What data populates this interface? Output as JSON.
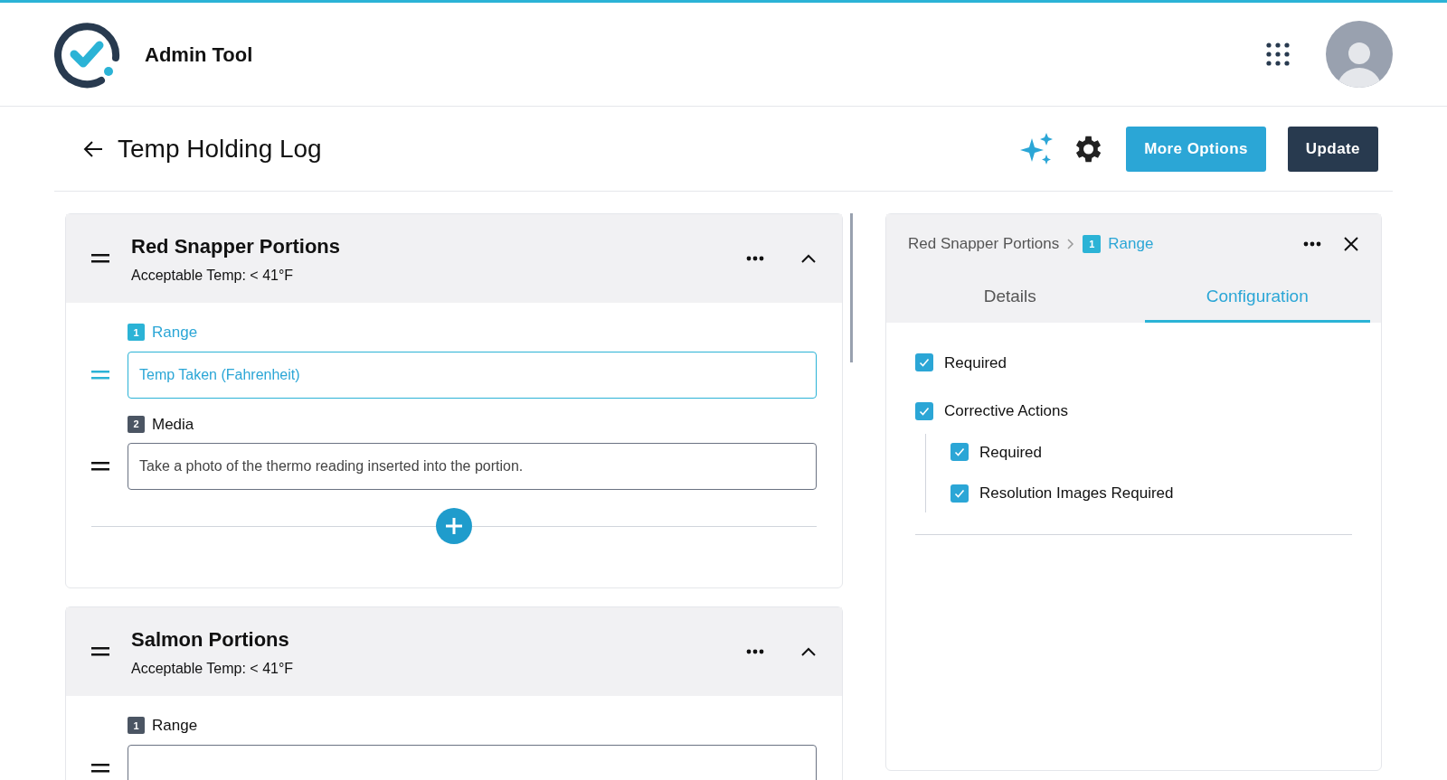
{
  "app": {
    "title": "Admin Tool"
  },
  "page": {
    "title": "Temp Holding Log",
    "buttons": [
      {
        "label": "More Options",
        "kind": "primary"
      },
      {
        "label": "Update",
        "kind": "dark"
      }
    ]
  },
  "sections": [
    {
      "title": "Red Snapper Portions",
      "subtitle": "Acceptable Temp: < 41°F",
      "expanded": true,
      "questions": [
        {
          "number": "1",
          "label": "Range",
          "text": "Temp Taken (Fahrenheit)",
          "selected": true
        },
        {
          "number": "2",
          "label": "Media",
          "text": "Take a photo of the thermo reading inserted into the portion.",
          "selected": false
        }
      ]
    },
    {
      "title": "Salmon Portions",
      "subtitle": "Acceptable Temp: < 41°F",
      "expanded": true,
      "questions": [
        {
          "number": "1",
          "label": "Range",
          "selected": false
        }
      ]
    }
  ],
  "detail_panel": {
    "breadcrumb": {
      "parent": "Red Snapper Portions",
      "number": "1",
      "current": "Range"
    },
    "tabs": [
      {
        "label": "Details",
        "selected": false
      },
      {
        "label": "Configuration",
        "selected": true
      }
    ],
    "options": [
      {
        "label": "Required",
        "checked": true
      },
      {
        "label": "Corrective Actions",
        "checked": true,
        "children": [
          {
            "label": "Required",
            "checked": true
          },
          {
            "label": "Resolution Images Required",
            "checked": true
          }
        ]
      }
    ]
  }
}
